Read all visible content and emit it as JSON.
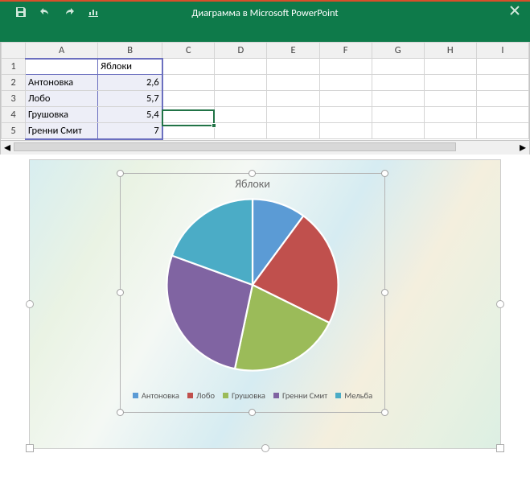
{
  "titlebar": {
    "title": "Диаграмма в Microsoft PowerPoint"
  },
  "sheet": {
    "columns": [
      "A",
      "B",
      "C",
      "D",
      "E",
      "F",
      "G",
      "H",
      "I"
    ],
    "header_cell": "Яблоки",
    "rows": [
      {
        "n": "2",
        "label": "Антоновка",
        "value": "2,6"
      },
      {
        "n": "3",
        "label": "Лобо",
        "value": "5,7"
      },
      {
        "n": "4",
        "label": "Грушовка",
        "value": "5,4"
      },
      {
        "n": "5",
        "label": "Гренни Смит",
        "value": "7"
      }
    ],
    "active_cell": "C4"
  },
  "chart_data": {
    "type": "pie",
    "title": "Яблоки",
    "series": [
      {
        "name": "Антоновка",
        "value": 2.6,
        "color": "#5b9bd5"
      },
      {
        "name": "Лобо",
        "value": 5.7,
        "color": "#c0504d"
      },
      {
        "name": "Грушовка",
        "value": 5.4,
        "color": "#9bbb59"
      },
      {
        "name": "Гренни Смит",
        "value": 7.0,
        "color": "#8064a2"
      },
      {
        "name": "Мельба",
        "value": 5.0,
        "color": "#4bacc6"
      }
    ]
  },
  "colors": {
    "ribbon": "#0e7a4a",
    "accent": "#217346"
  }
}
